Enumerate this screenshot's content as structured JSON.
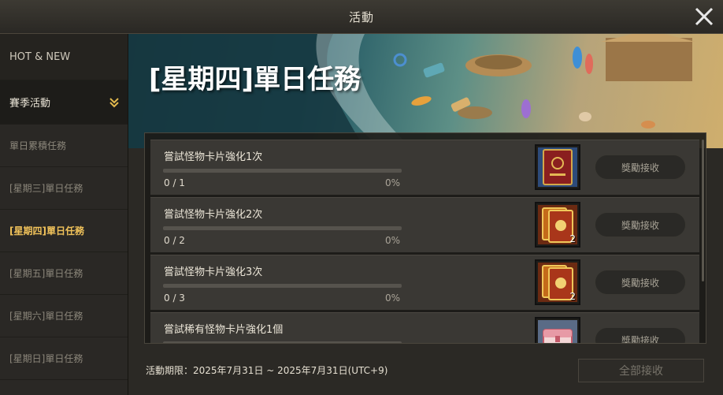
{
  "window": {
    "title": "活動"
  },
  "sidebar": {
    "items": [
      {
        "label": "HOT & NEW",
        "kind": "header"
      },
      {
        "label": "賽季活動",
        "kind": "group",
        "expanded": true
      },
      {
        "label": "單日累積任務",
        "kind": "item"
      },
      {
        "label": "[星期三]單日任務",
        "kind": "item"
      },
      {
        "label": "[星期四]單日任務",
        "kind": "item",
        "active": true
      },
      {
        "label": "[星期五]單日任務",
        "kind": "item"
      },
      {
        "label": "[星期六]單日任務",
        "kind": "item"
      },
      {
        "label": "[星期日]單日任務",
        "kind": "item"
      }
    ]
  },
  "main": {
    "banner_title": "[星期四]單日任務",
    "tasks": [
      {
        "name": "嘗試怪物卡片強化1次",
        "count": "0 / 1",
        "percent": "0%",
        "progress": 0,
        "reward_qty": "",
        "claim_label": "獎勵接收",
        "reward_icon": "monster-card-book-icon"
      },
      {
        "name": "嘗試怪物卡片強化2次",
        "count": "0 / 2",
        "percent": "0%",
        "progress": 0,
        "reward_qty": "2",
        "claim_label": "獎勵接收",
        "reward_icon": "card-pack-icon"
      },
      {
        "name": "嘗試怪物卡片強化3次",
        "count": "0 / 3",
        "percent": "0%",
        "progress": 0,
        "reward_qty": "2",
        "claim_label": "獎勵接收",
        "reward_icon": "card-pack-icon"
      },
      {
        "name": "嘗試稀有怪物卡片強化1個",
        "count": "",
        "percent": "",
        "progress": 0,
        "reward_qty": "",
        "claim_label": "獎勵接收",
        "reward_icon": "pink-chest-icon"
      }
    ],
    "period": "活動期限：2025年7月31日 ~ 2025年7月31日(UTC+9)",
    "claim_all_label": "全部接收"
  },
  "colors": {
    "active": "#f0c25a",
    "accent_progress": "#d1b56a"
  }
}
